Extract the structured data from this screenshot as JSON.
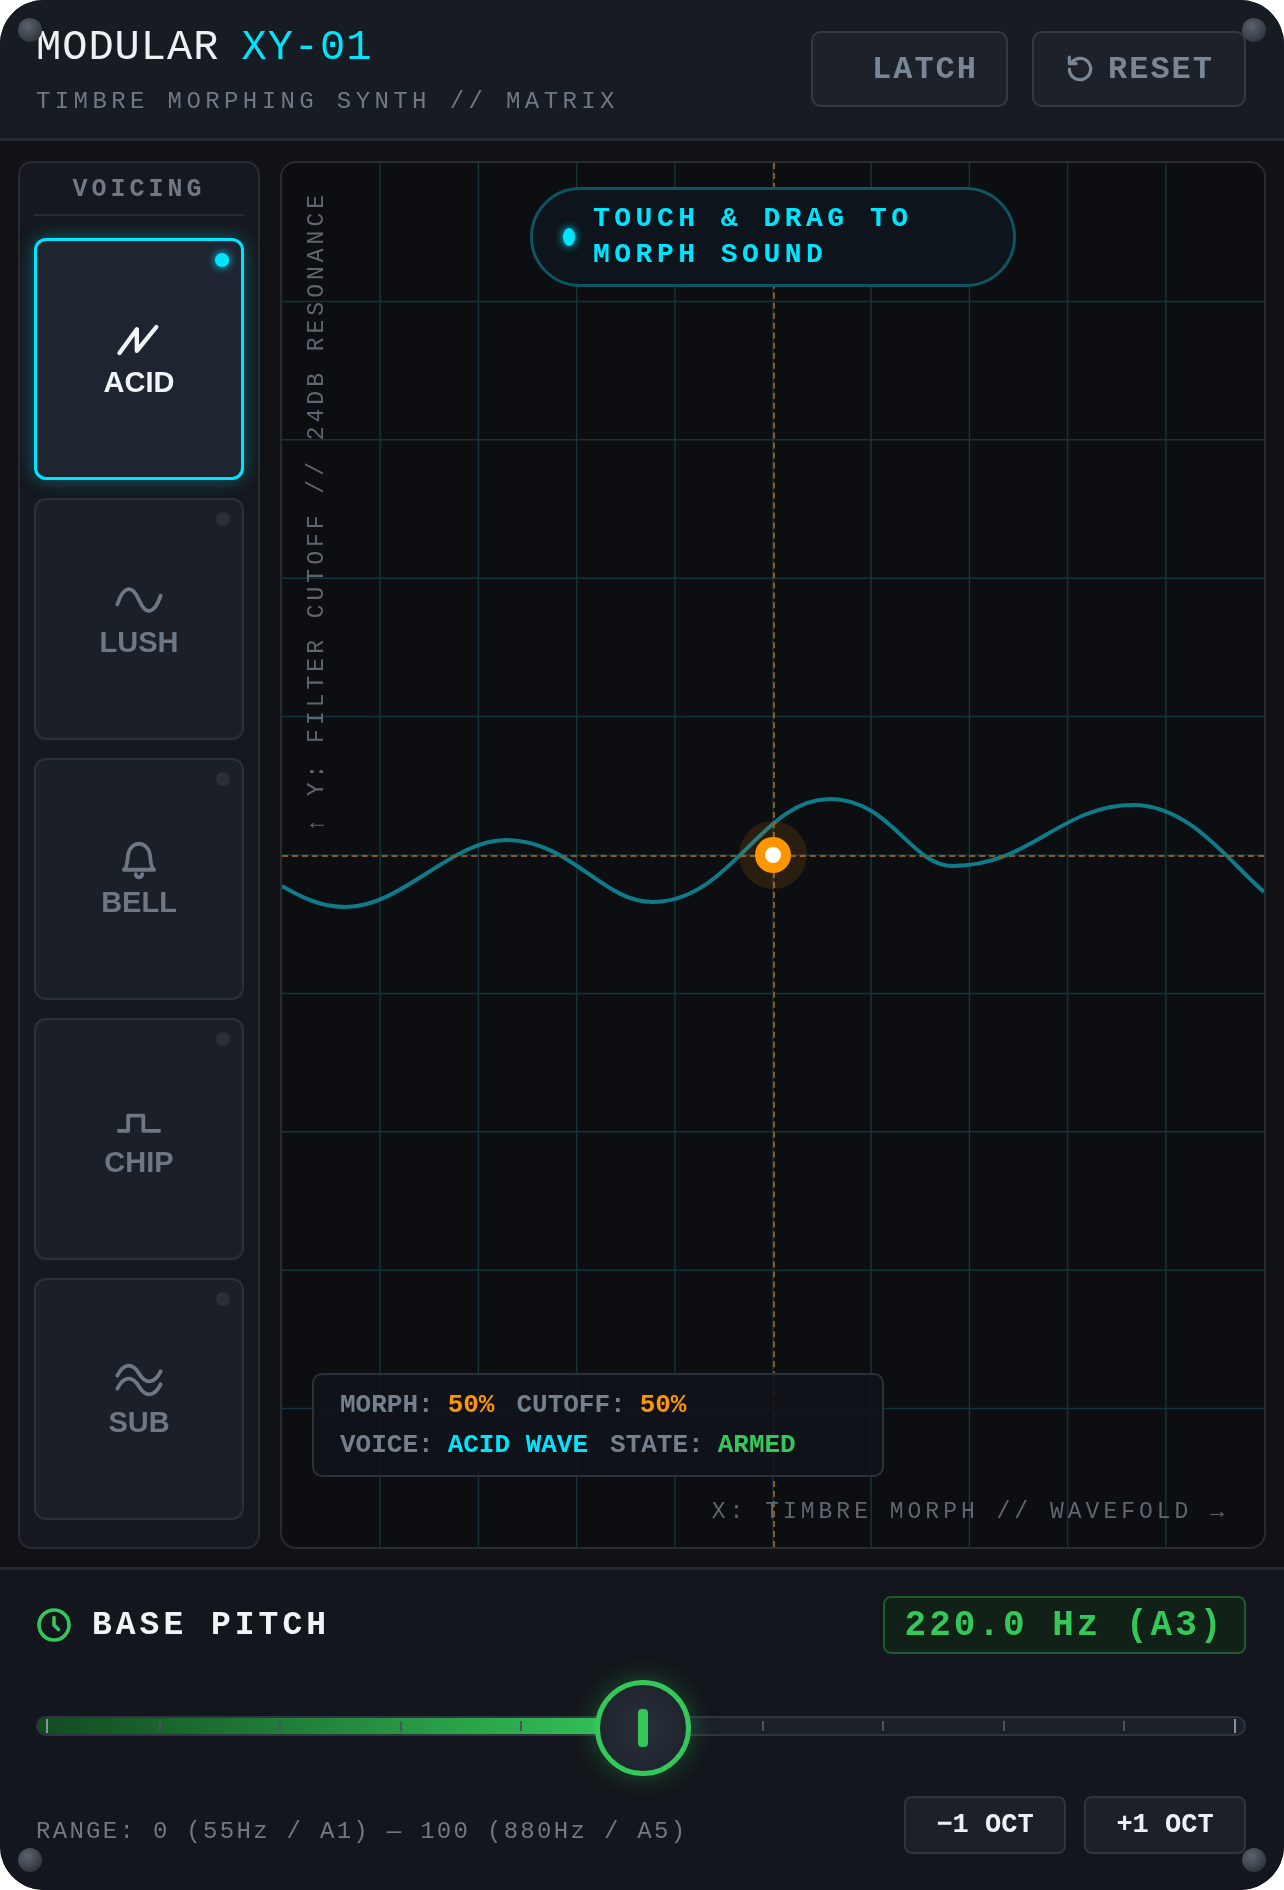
{
  "header": {
    "title": "MODULAR",
    "model": "XY-01",
    "subtitle": "TIMBRE MORPHING SYNTH // MATRIX",
    "buttons": [
      {
        "label": "LATCH",
        "kind": "toggle"
      },
      {
        "label": "RESET",
        "kind": "reset"
      }
    ]
  },
  "sidebar": {
    "heading": "VOICING",
    "voices": [
      {
        "label": "ACID",
        "kind": "saw",
        "selected": true
      },
      {
        "label": "LUSH",
        "kind": "sine",
        "selected": false
      },
      {
        "label": "BELL",
        "kind": "bell",
        "selected": false
      },
      {
        "label": "CHIP",
        "kind": "square",
        "selected": false
      },
      {
        "label": "SUB",
        "kind": "double",
        "selected": false
      }
    ]
  },
  "pad": {
    "hint": "TOUCH & DRAG TO MORPH SOUND",
    "y_axis": "↑ Y: FILTER CUTOFF // 24DB RESONANCE",
    "x_axis": "X: TIMBRE MORPH // WAVEFOLD →",
    "puck_x": {
      "level": 0.5
    },
    "puck_y": {
      "level": 0.5
    },
    "readout": [
      [
        {
          "label": "MORPH:",
          "value": "50%",
          "color": "#ff9500"
        },
        {
          "label": "CUTOFF:",
          "value": "50%",
          "color": "#ff9500"
        }
      ],
      [
        {
          "label": "VOICE:",
          "value": "ACID WAVE",
          "color": "#00e5ff"
        },
        {
          "label": "STATE:",
          "value": "ARMED",
          "color": "#34c759"
        }
      ]
    ]
  },
  "pitch": {
    "title": "BASE PITCH",
    "display": "220.0 Hz (A3)",
    "slider": {
      "level": 0.5
    },
    "range": "RANGE: 0 (55Hz / A1) — 100 (880Hz / A5)",
    "buttons": [
      "−1 OCT",
      "+1 OCT"
    ]
  }
}
